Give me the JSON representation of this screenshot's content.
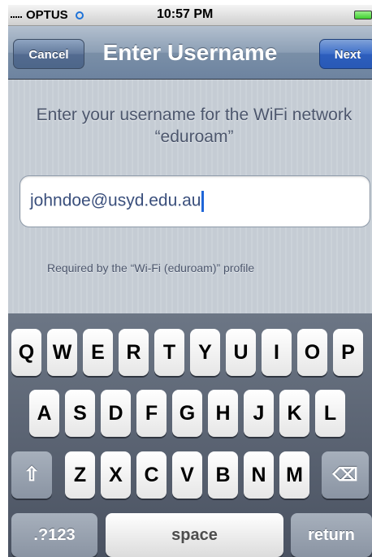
{
  "status_bar": {
    "carrier": "OPTUS",
    "time": "10:57 PM"
  },
  "nav": {
    "title": "Enter Username",
    "cancel_label": "Cancel",
    "next_label": "Next"
  },
  "content": {
    "prompt": "Enter your username for the WiFi network “eduroam”",
    "username_value": "johndoe@usyd.edu.au",
    "footer_note": "Required by the “Wi-Fi (eduroam)” profile"
  },
  "keyboard": {
    "row1": [
      "Q",
      "W",
      "E",
      "R",
      "T",
      "Y",
      "U",
      "I",
      "O",
      "P"
    ],
    "row2": [
      "A",
      "S",
      "D",
      "F",
      "G",
      "H",
      "J",
      "K",
      "L"
    ],
    "row3": [
      "Z",
      "X",
      "C",
      "V",
      "B",
      "N",
      "M"
    ],
    "shift_glyph": "⇧",
    "delete_glyph": "⌫",
    "numbers_label": ".?123",
    "space_label": "space",
    "return_label": "return"
  }
}
